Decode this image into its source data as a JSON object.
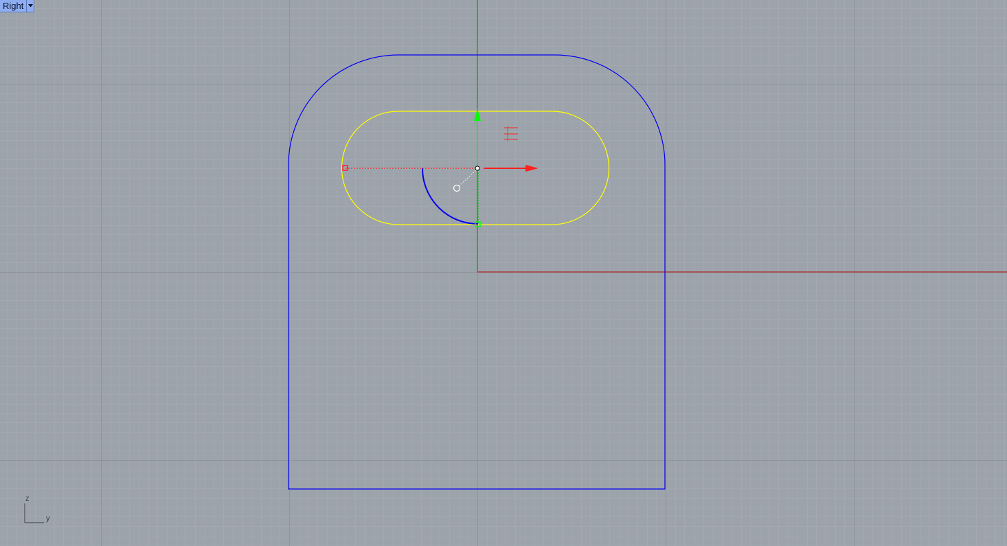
{
  "viewport": {
    "title": "Right",
    "menu_icon": "chevron-down-icon"
  },
  "axis_icon": {
    "vertical_label": "z",
    "horizontal_label": "y"
  },
  "colors": {
    "background": "#9da3ab",
    "grid_minor": "#a4a9b1",
    "grid_major": "#8f949b",
    "outer_curve": "#0000ff",
    "slot_curve": "#ffff00",
    "x_axis": "#b03030",
    "y_axis": "#00c000",
    "gumball_x": "#ff2020",
    "gumball_y": "#00ff00"
  }
}
